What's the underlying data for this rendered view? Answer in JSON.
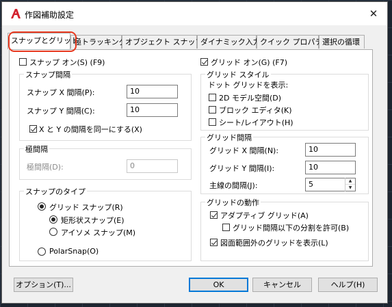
{
  "window": {
    "title": "作図補助設定",
    "close_glyph": "✕"
  },
  "tabs": [
    {
      "label": "スナップとグリッド",
      "active": true
    },
    {
      "label": "極トラッキング",
      "active": false
    },
    {
      "label": "オブジェクト スナップ",
      "active": false
    },
    {
      "label": "ダイナミック入力",
      "active": false
    },
    {
      "label": "クイック プロパティ",
      "active": false
    },
    {
      "label": "選択の循環",
      "active": false
    }
  ],
  "snap": {
    "snap_on": {
      "label": "スナップ オン(S) (F9)",
      "checked": false
    },
    "spacing_group": "スナップ間隔",
    "x_label": "スナップ X 間隔(P):",
    "x_value": "10",
    "y_label": "スナップ Y 間隔(C):",
    "y_value": "10",
    "equal": {
      "label": "X と Y の間隔を同一にする(X)",
      "checked": true
    },
    "polar_group": "極間隔",
    "polar_label": "極間隔(D):",
    "polar_value": "0",
    "type_group": "スナップのタイプ",
    "grid_snap": {
      "label": "グリッド スナップ(R)",
      "selected": true
    },
    "rect_snap": {
      "label": "矩形状スナップ(E)",
      "selected": true
    },
    "iso_snap": {
      "label": "アイソメ スナップ(M)",
      "selected": false
    },
    "polar_snap": {
      "label": "PolarSnap(O)",
      "selected": false
    }
  },
  "grid": {
    "grid_on": {
      "label": "グリッド オン(G) (F7)",
      "checked": true
    },
    "style_group": "グリッド スタイル",
    "dot_label": "ドット グリッドを表示:",
    "model_space": {
      "label": "2D モデル空間(D)",
      "checked": false
    },
    "block_editor": {
      "label": "ブロック エディタ(K)",
      "checked": false
    },
    "sheet_layout": {
      "label": "シート/レイアウト(H)",
      "checked": false
    },
    "spacing_group": "グリッド間隔",
    "x_label": "グリッド X 間隔(N):",
    "x_value": "10",
    "y_label": "グリッド Y 間隔(I):",
    "y_value": "10",
    "major_label": "主線の間隔(J):",
    "major_value": "5",
    "behavior_group": "グリッドの動作",
    "adaptive": {
      "label": "アダプティブ グリッド(A)",
      "checked": true
    },
    "subdivide": {
      "label": "グリッド間隔以下の分割を許可(B)",
      "checked": false
    },
    "beyond_limits": {
      "label": "図面範囲外のグリッドを表示(L)",
      "checked": true
    }
  },
  "buttons": {
    "options": "オプション(T)...",
    "ok": "OK",
    "cancel": "キャンセル",
    "help": "ヘルプ(H)"
  },
  "colors": {
    "highlight_ring": "#e8391f",
    "app_icon": "#d3232f",
    "default_button_border": "#0078d7"
  }
}
